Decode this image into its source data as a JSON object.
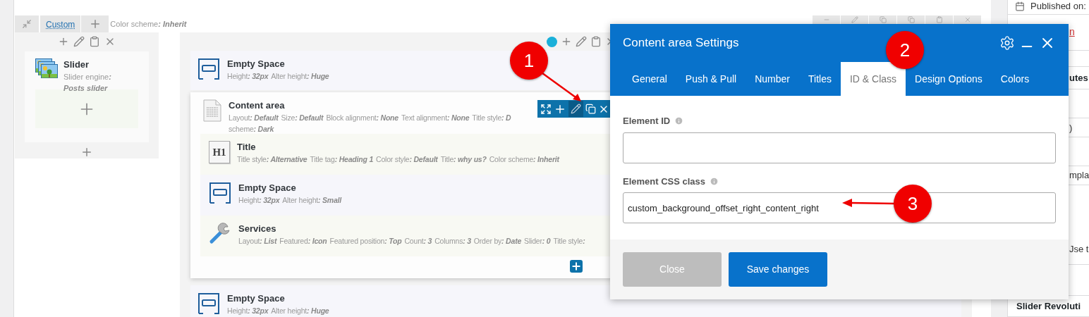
{
  "row": {
    "layout_tab": "Custom",
    "color_scheme": {
      "label": "Color scheme",
      "value": ": Inherit"
    }
  },
  "left_column": {
    "elements": [
      {
        "kind": "slider",
        "name": "Slider",
        "lines": [
          [
            {
              "label": "Slider engine",
              "value": ": Posts slider"
            }
          ]
        ]
      }
    ]
  },
  "right_column": {
    "elements": [
      {
        "kind": "empty_space",
        "name": "Empty Space",
        "lines": [
          [
            {
              "label": "Height",
              "value": ": 32px"
            },
            {
              "label": "Alter height",
              "value": ": Huge"
            }
          ]
        ]
      },
      {
        "kind": "content_area",
        "name": "Content area",
        "lines": [
          [
            {
              "label": "Layout",
              "value": ": Default"
            },
            {
              "label": "Size",
              "value": ": Default"
            },
            {
              "label": "Block alignment",
              "value": ": None"
            },
            {
              "label": "Text alignment",
              "value": ": None"
            },
            {
              "label": "Title style",
              "value": ": D"
            }
          ],
          [
            {
              "label": "scheme",
              "value": ": Dark"
            }
          ]
        ],
        "children": [
          {
            "kind": "title",
            "name": "Title",
            "icon_text": "H1",
            "lines": [
              [
                {
                  "label": "Title style",
                  "value": ": Alternative"
                },
                {
                  "label": "Title tag",
                  "value": ": Heading 1"
                },
                {
                  "label": "Color style",
                  "value": ": Default"
                },
                {
                  "label": "Title",
                  "value": ": why us?"
                },
                {
                  "label": "Color scheme",
                  "value": ": Inherit"
                }
              ]
            ]
          },
          {
            "kind": "empty_space",
            "name": "Empty Space",
            "lines": [
              [
                {
                  "label": "Height",
                  "value": ": 32px"
                },
                {
                  "label": "Alter height",
                  "value": ": Small"
                }
              ]
            ]
          },
          {
            "kind": "services",
            "name": "Services",
            "lines": [
              [
                {
                  "label": "Layout",
                  "value": ": List"
                },
                {
                  "label": "Featured",
                  "value": ": Icon"
                },
                {
                  "label": "Featured position",
                  "value": ": Top"
                },
                {
                  "label": "Count",
                  "value": ": 3"
                },
                {
                  "label": "Columns",
                  "value": ": 3"
                },
                {
                  "label": "Order by",
                  "value": ": Date"
                },
                {
                  "label": "Slider",
                  "value": ": 0"
                },
                {
                  "label": "Title style",
                  "value": ":"
                }
              ]
            ]
          }
        ]
      },
      {
        "kind": "empty_space",
        "name": "Empty Space",
        "lines": [
          [
            {
              "label": "Height",
              "value": ": 32px"
            },
            {
              "label": "Alter height",
              "value": ": Huge"
            }
          ]
        ]
      }
    ]
  },
  "dialog": {
    "title": "Content area Settings",
    "tabs": [
      {
        "label": "General",
        "selected": false
      },
      {
        "label": "Push & Pull",
        "selected": false
      },
      {
        "label": "Number",
        "selected": false
      },
      {
        "label": "Titles",
        "selected": false
      },
      {
        "label": "ID & Class",
        "selected": true
      },
      {
        "label": "Design Options",
        "selected": false
      },
      {
        "label": "Colors",
        "selected": false
      }
    ],
    "fields": [
      {
        "label": "Element ID"
      },
      {
        "label": "Element CSS class",
        "value": "custom_background_offset_right_content_right"
      }
    ],
    "buttons": [
      {
        "label": "Close",
        "kind": "secondary"
      },
      {
        "label": "Save changes",
        "kind": "primary"
      }
    ]
  },
  "sidebar": {
    "items": [
      {
        "kind": "meta",
        "text": "Published on:"
      },
      {
        "kind": "link",
        "text": "n"
      },
      {
        "kind": "heading",
        "text": "utes"
      },
      {
        "kind": "text",
        "text": ")"
      },
      {
        "kind": "text",
        "text": "mpla"
      },
      {
        "kind": "text",
        "text": "Jse t"
      },
      {
        "kind": "heading",
        "text": "Slider Revoluti"
      }
    ]
  },
  "annotations": [
    {
      "number": "1"
    },
    {
      "number": "2"
    },
    {
      "number": "3"
    }
  ]
}
